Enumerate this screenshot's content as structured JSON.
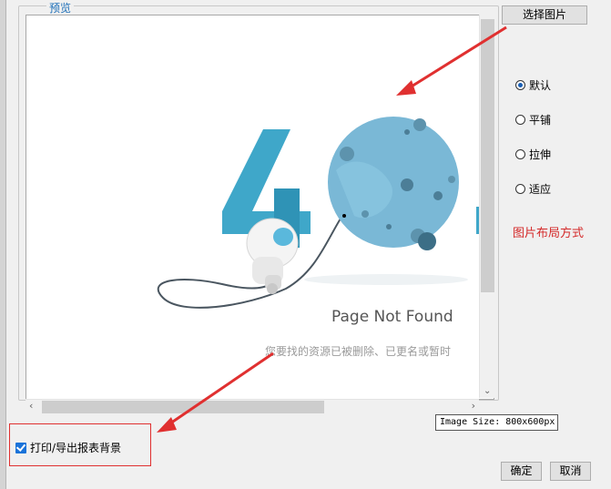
{
  "preview": {
    "legend": "预览",
    "page_not_found": "Page Not Found",
    "page_not_found_sub": "您要找的资源已被删除、已更名或暂时"
  },
  "buttons": {
    "select_image": "选择图片",
    "ok": "确定",
    "cancel": "取消"
  },
  "layout_options": [
    {
      "label": "默认",
      "selected": true
    },
    {
      "label": "平铺",
      "selected": false
    },
    {
      "label": "拉伸",
      "selected": false
    },
    {
      "label": "适应",
      "selected": false
    }
  ],
  "layout_note": "图片布局方式",
  "image_size_tooltip": "Image Size: 800x600px",
  "print_background": {
    "label": "打印/导出报表背景",
    "checked": true
  },
  "colors": {
    "accent": "#1a73d9",
    "annotation": "#e03030",
    "four_blue": "#3fa7c9",
    "moon_blue": "#7ab8d6"
  }
}
